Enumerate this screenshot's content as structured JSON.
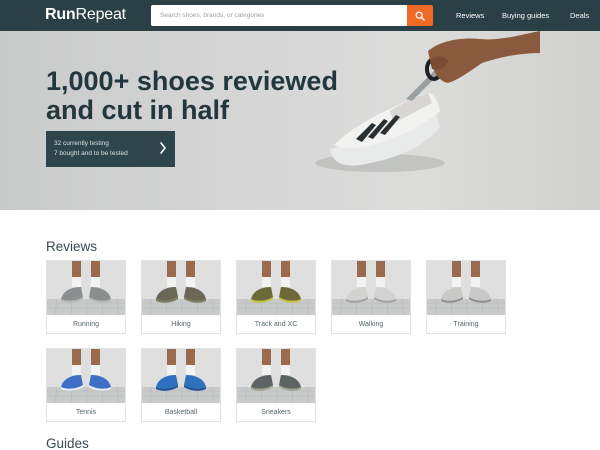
{
  "header": {
    "logo_bold": "Run",
    "logo_light": "Repeat",
    "search_placeholder": "Search shoes, brands, or categories",
    "nav": [
      "Reviews",
      "Buying guides",
      "Deals"
    ]
  },
  "hero": {
    "title_line1": "1,000+ shoes reviewed",
    "title_line2": "and cut in half",
    "stat1": "32 currently testing",
    "stat2": "7 bought and to be tested"
  },
  "reviews": {
    "title": "Reviews",
    "items": [
      {
        "label": "Running",
        "shoe_color": "#8c8f90",
        "accent": "#b7b9b8"
      },
      {
        "label": "Hiking",
        "shoe_color": "#6b6656",
        "accent": "#7b7d5c"
      },
      {
        "label": "Track and XC",
        "shoe_color": "#6d6a3a",
        "accent": "#c3c23c"
      },
      {
        "label": "Walking",
        "shoe_color": "#d2d2d0",
        "accent": "#9fa1a2"
      },
      {
        "label": "Training",
        "shoe_color": "#c9cac8",
        "accent": "#8d8f90"
      },
      {
        "label": "Tennis",
        "shoe_color": "#3f6fc4",
        "accent": "#e8eef5"
      },
      {
        "label": "Basketball",
        "shoe_color": "#2e6fbe",
        "accent": "#1e4f96"
      },
      {
        "label": "Sneakers",
        "shoe_color": "#5d6263",
        "accent": "#9ea38c"
      }
    ]
  },
  "guides": {
    "title": "Guides"
  },
  "colors": {
    "header_bg": "#2b3f46",
    "accent": "#ef6a25",
    "hero_box": "#2f454d"
  }
}
